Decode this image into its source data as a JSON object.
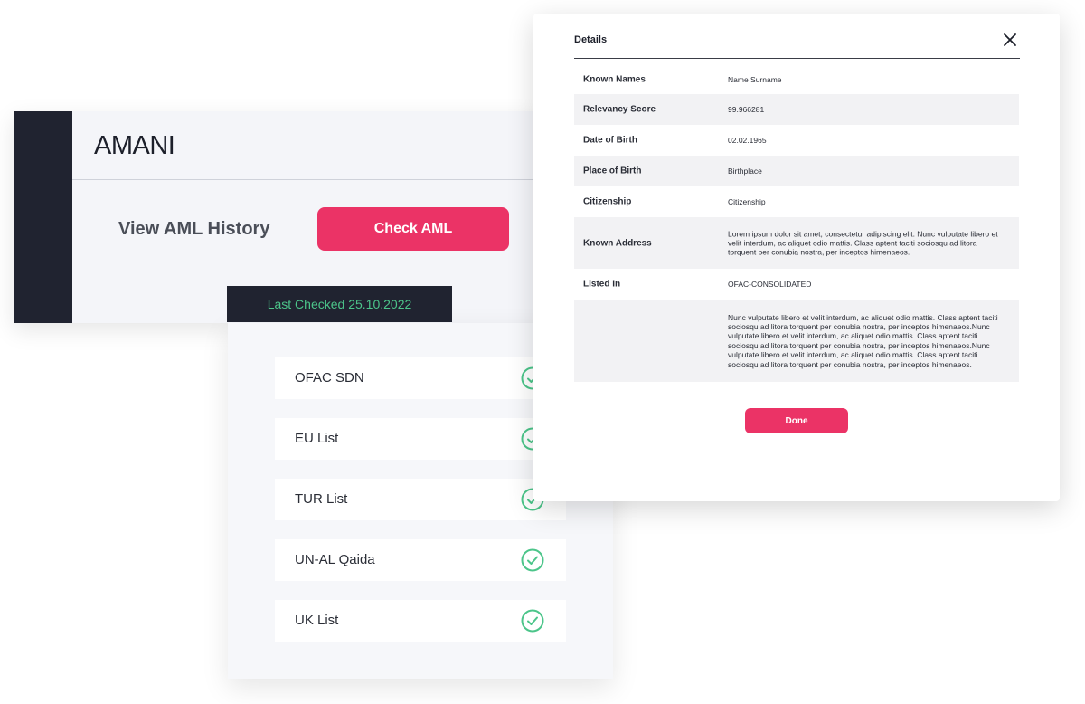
{
  "main": {
    "logo": "AMANI",
    "history_link": "View AML History",
    "check_button": "Check AML",
    "last_checked": "Last Checked 25.10.2022",
    "accent_color": "#eb3366",
    "success_color": "#4cc58a"
  },
  "lists": [
    {
      "label": "OFAC SDN",
      "status_icon": "check-circle-icon"
    },
    {
      "label": "EU List",
      "status_icon": "check-circle-icon"
    },
    {
      "label": "TUR List",
      "status_icon": "check-circle-icon"
    },
    {
      "label": "UN-AL Qaida",
      "status_icon": "check-circle-icon"
    },
    {
      "label": "UK List",
      "status_icon": "check-circle-icon"
    }
  ],
  "details": {
    "title": "Details",
    "close_icon": "close-icon",
    "rows": [
      {
        "key": "Known Names",
        "value": "Name Surname"
      },
      {
        "key": "Relevancy Score",
        "value": "99.966281"
      },
      {
        "key": "Date of Birth",
        "value": "02.02.1965"
      },
      {
        "key": "Place of Birth",
        "value": "Birthplace"
      },
      {
        "key": "Citizenship",
        "value": "Citizenship"
      },
      {
        "key": "Known Address",
        "value": "Lorem ipsum dolor sit amet, consectetur adipiscing elit. Nunc vulputate libero et velit interdum, ac aliquet odio mattis. Class aptent taciti sociosqu ad litora torquent per conubia nostra, per inceptos himenaeos."
      },
      {
        "key": "Listed In",
        "value": "OFAC-CONSOLIDATED"
      },
      {
        "key": "",
        "value": "Nunc vulputate libero et velit interdum, ac aliquet odio mattis. Class aptent taciti sociosqu ad litora torquent per conubia nostra, per inceptos himenaeos.Nunc vulputate libero et velit interdum, ac aliquet odio mattis. Class aptent taciti sociosqu ad litora torquent per conubia nostra, per inceptos himenaeos.Nunc vulputate libero et velit interdum, ac aliquet odio mattis. Class aptent taciti sociosqu ad litora torquent per conubia nostra, per inceptos himenaeos."
      }
    ],
    "done_button": "Done"
  }
}
